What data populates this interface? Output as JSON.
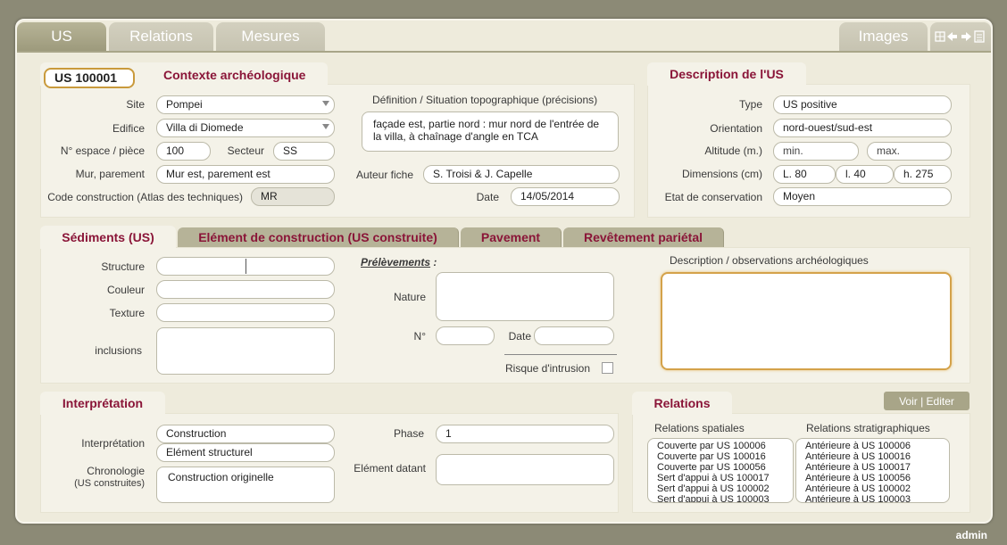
{
  "top_tabs": {
    "us": "US",
    "relations": "Relations",
    "mesures": "Mesures",
    "images": "Images"
  },
  "us_id": "US  100001",
  "contexte": {
    "title": "Contexte archéologique",
    "site_label": "Site",
    "site_value": "Pompei",
    "edifice_label": "Edifice",
    "edifice_value": "Villa di Diomede",
    "espace_label": "N° espace / pièce",
    "espace_value": "100",
    "secteur_label": "Secteur",
    "secteur_value": "SS",
    "mur_label": "Mur, parement",
    "mur_value": "Mur est, parement est",
    "code_label": "Code construction (Atlas des techniques)",
    "code_value": "MR",
    "definition_label": "Définition / Situation topographique (précisions)",
    "definition_value": "façade est, partie nord : mur nord de l'entrée de la villa, à chaînage d'angle en TCA",
    "auteur_label": "Auteur fiche",
    "auteur_value": "S. Troisi & J. Capelle",
    "date_label": "Date",
    "date_value": "14/05/2014"
  },
  "description_us": {
    "title": "Description de l'US",
    "type_label": "Type",
    "type_value": "US positive",
    "orientation_label": "Orientation",
    "orientation_value": "nord-ouest/sud-est",
    "altitude_label": "Altitude (m.)",
    "alt_min": "min.",
    "alt_max": "max.",
    "dimensions_label": "Dimensions (cm)",
    "dim_l": "L. 80",
    "dim_w": "l. 40",
    "dim_h": "h. 275",
    "etat_label": "Etat de conservation",
    "etat_value": "Moyen"
  },
  "sub_tabs": {
    "sediments": "Sédiments (US)",
    "element": "Elément de construction (US construite)",
    "pavement": "Pavement",
    "revetement": "Revêtement pariétal"
  },
  "sediments": {
    "structure_label": "Structure",
    "couleur_label": "Couleur",
    "texture_label": "Texture",
    "inclusions_label": "inclusions",
    "prelevements_label": "Prélèvements",
    "prelevements_colon": " :",
    "nature_label": "Nature",
    "numero_label": "N°",
    "date_label": "Date",
    "risque_label": "Risque d'intrusion",
    "description_label": "Description / observations archéologiques"
  },
  "interpretation": {
    "title": "Interprétation",
    "interp_label": "Interprétation",
    "interp_value_1": "Construction",
    "interp_value_2": "Elément structurel",
    "chrono_label_1": "Chronologie",
    "chrono_label_2": "(US construites)",
    "chrono_value": "Construction originelle",
    "phase_label": "Phase",
    "phase_value": "1",
    "element_datant_label": "Elément datant"
  },
  "relations": {
    "title": "Relations",
    "voir_button": "Voir | Editer",
    "spatiales_label": "Relations spatiales",
    "strati_label": "Relations stratigraphiques",
    "spatiales": [
      "Couverte par US 100006",
      "Couverte par US 100016",
      "Couverte par US 100056",
      "Sert d'appui à US 100017",
      "Sert d'appui à US 100002",
      "Sert d'appui à US 100003"
    ],
    "strati": [
      "Antérieure à US 100006",
      "Antérieure à US 100016",
      "Antérieure à US 100017",
      "Antérieure à US 100056",
      "Antérieure à US 100002",
      "Antérieure à US 100003"
    ]
  },
  "user": "admin",
  "icons": [
    "grid-icon",
    "arrow-left-icon",
    "arrow-right-icon",
    "document-icon"
  ],
  "colors": {
    "accent": "#8a1538",
    "tab_active": "#a8a588",
    "frame": "#eeebdc"
  }
}
